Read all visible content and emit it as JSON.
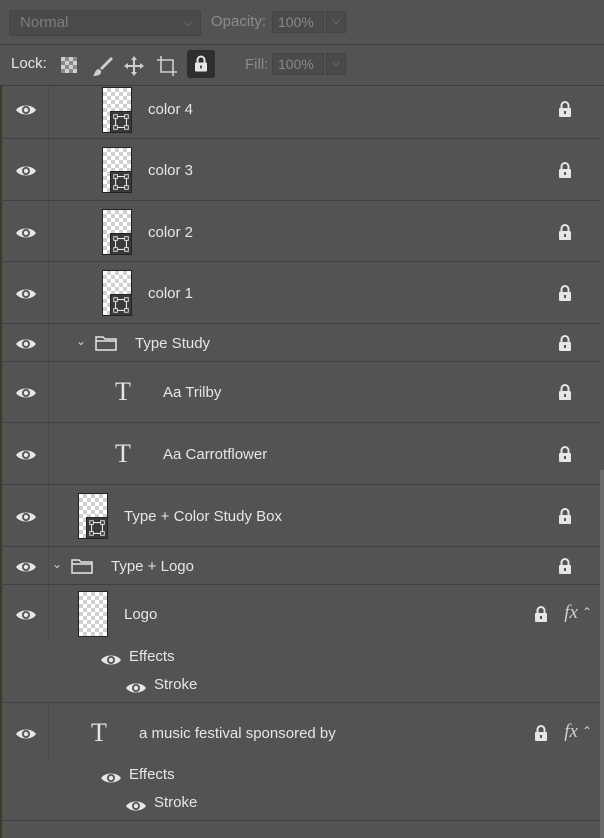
{
  "toolbar": {
    "blend_mode": "Normal",
    "opacity_label": "Opacity:",
    "opacity_value": "100%",
    "lock_label": "Lock:",
    "fill_label": "Fill:",
    "fill_value": "100%"
  },
  "layers": {
    "color4": "color 4",
    "color3": "color 3",
    "color2": "color 2",
    "color1": "color 1",
    "type_study_group": "Type Study",
    "trilby": "Aa Trilby",
    "carrotflower": "Aa Carrotflower",
    "study_box": "Type + Color Study Box",
    "type_logo_group": "Type + Logo",
    "logo": "Logo",
    "logo_effects": "Effects",
    "logo_stroke": "Stroke",
    "festival": "a music festival sponsored by",
    "festival_effects": "Effects",
    "festival_stroke": "Stroke",
    "fx_label": "fx"
  },
  "icons": {
    "eye": "eye-icon",
    "lock": "lock-icon",
    "folder": "folder-icon",
    "type": "type-layer-icon",
    "shape": "shape-layer-icon"
  },
  "colors": {
    "panel_bg": "#535353",
    "selected_lock": "#2e2e2e",
    "divider": "#404040"
  }
}
